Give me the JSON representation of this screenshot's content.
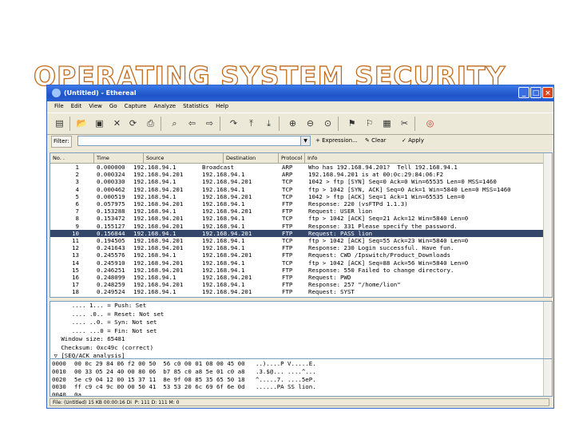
{
  "slide_title": "OPERATING SYSTEM SECURITY",
  "window": {
    "title": "(Untitled) - Ethereal",
    "controls": [
      "_",
      "□",
      "×"
    ]
  },
  "menu": [
    "File",
    "Edit",
    "View",
    "Go",
    "Capture",
    "Analyze",
    "Statistics",
    "Help"
  ],
  "toolbar": {
    "icons": [
      "interface-list-icon",
      "open-icon",
      "save-icon",
      "close-icon",
      "reload-icon",
      "print-icon",
      "find-icon",
      "back-icon",
      "forward-icon",
      "goto-icon",
      "first-icon",
      "last-icon",
      "zoom-in-icon",
      "zoom-out-icon",
      "zoom-normal-icon",
      "capture-filter-icon",
      "display-filter-icon",
      "coloring-icon",
      "preferences-icon",
      "help-icon"
    ]
  },
  "filter": {
    "label": "Filter:",
    "value": "",
    "expression": "+ Expression...",
    "clear": "Clear",
    "apply": "Apply"
  },
  "packet_list": {
    "columns": [
      "No. .",
      "Time",
      "Source",
      "Destination",
      "Protocol",
      "Info"
    ],
    "selected_no": "10",
    "rows": [
      [
        "1",
        "0.000000",
        "192.168.94.1",
        "Broadcast",
        "ARP",
        "Who has 192.168.94.201?  Tell 192.168.94.1"
      ],
      [
        "2",
        "0.000324",
        "192.168.94.201",
        "192.168.94.1",
        "ARP",
        "192.168.94.201 is at 00:0c:29:84:06:F2"
      ],
      [
        "3",
        "0.000330",
        "192.168.94.1",
        "192.168.94.201",
        "TCP",
        "1042 > ftp [SYN] Seq=0 Ack=0 Win=65535 Len=0 MSS=1460"
      ],
      [
        "4",
        "0.000462",
        "192.168.94.201",
        "192.168.94.1",
        "TCP",
        "ftp > 1042 [SYN, ACK] Seq=0 Ack=1 Win=5840 Len=0 MSS=1460"
      ],
      [
        "5",
        "0.000519",
        "192.168.94.1",
        "192.168.94.201",
        "TCP",
        "1042 > ftp [ACK] Seq=1 Ack=1 Win=65535 Len=0"
      ],
      [
        "6",
        "0.057975",
        "192.168.94.201",
        "192.168.94.1",
        "FTP",
        "Response: 220 (vsFTPd 1.1.3)"
      ],
      [
        "7",
        "0.153288",
        "192.168.94.1",
        "192.168.94.201",
        "FTP",
        "Request: USER lion"
      ],
      [
        "8",
        "0.153472",
        "192.168.94.201",
        "192.168.94.1",
        "TCP",
        "ftp > 1042 [ACK] Seq=21 Ack=12 Win=5840 Len=0"
      ],
      [
        "9",
        "0.155127",
        "192.168.94.201",
        "192.168.94.1",
        "FTP",
        "Response: 331 Please specify the password."
      ],
      [
        "10",
        "0.156844",
        "192.168.94.1",
        "192.168.94.201",
        "FTP",
        "Request: PASS lion"
      ],
      [
        "11",
        "0.194505",
        "192.168.94.201",
        "192.168.94.1",
        "TCP",
        "ftp > 1042 [ACK] Seq=55 Ack=23 Win=5840 Len=0"
      ],
      [
        "12",
        "0.241643",
        "192.168.94.201",
        "192.168.94.1",
        "FTP",
        "Response: 230 Login successful. Have fun."
      ],
      [
        "13",
        "0.245576",
        "192.168.94.1",
        "192.168.94.201",
        "FTP",
        "Request: CWD /Ipswitch/Product_Downloads"
      ],
      [
        "14",
        "0.245910",
        "192.168.94.201",
        "192.168.94.1",
        "TCP",
        "ftp > 1042 [ACK] Seq=88 Ack=56 Win=5840 Len=0"
      ],
      [
        "15",
        "0.246251",
        "192.168.94.201",
        "192.168.94.1",
        "FTP",
        "Response: 550 Failed to change directory."
      ],
      [
        "16",
        "0.248099",
        "192.168.94.1",
        "192.168.94.201",
        "FTP",
        "Request: PWD"
      ],
      [
        "17",
        "0.248259",
        "192.168.94.201",
        "192.168.94.1",
        "FTP",
        "Response: 257 \"/home/lion\""
      ],
      [
        "18",
        "0.249524",
        "192.168.94.1",
        "192.168.94.201",
        "FTP",
        "Request: SYST"
      ]
    ]
  },
  "details": [
    "      .... 1... = Push: Set",
    "      .... .0.. = Reset: Not set",
    "      .... ..0. = Syn: Not set",
    "      .... ...0 = Fin: Not set",
    "   Window size: 65481",
    "   Checksum: 0xc49c (correct)",
    " ▽ [SEQ/ACK analysis]"
  ],
  "hex": [
    [
      "0000",
      "00 0c 29 84 06 f2 00 50  56 c0 00 01 08 00 45 00",
      "..)....P V.....E."
    ],
    [
      "0010",
      "00 33 05 24 40 00 80 06  b7 85 c0 a8 5e 01 c0 a8",
      ".3.$@... ....^..."
    ],
    [
      "0020",
      "5e c9 04 12 00 15 37 11  8e 9f 08 85 35 65 50 18",
      "^.....7. ....5eP."
    ],
    [
      "0030",
      "ff c9 c4 9c 00 00 50 41  53 53 20 6c 69 6f 6e 0d",
      "......PA SS lion."
    ],
    [
      "0040",
      "0a",
      ""
    ]
  ],
  "status": "File: (Untitled) 15 KB 00:00:16 Di  P: 111 D: 111 M: 0",
  "colors": {
    "title_outline": "#c26a1c",
    "titlebar": "#1f55c7",
    "selected_row": "#34476b"
  }
}
